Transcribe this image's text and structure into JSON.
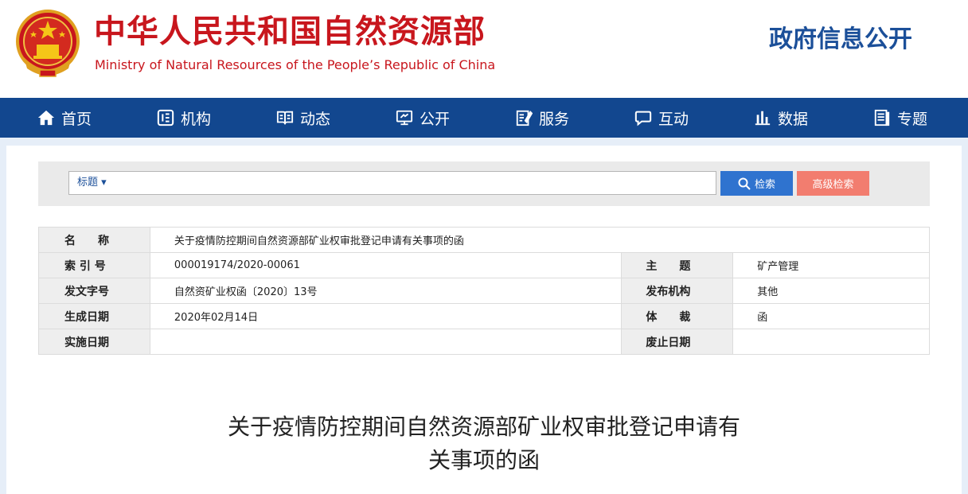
{
  "header": {
    "title_cn": "中华人民共和国自然资源部",
    "title_en": "Ministry of Natural Resources of the People’s Republic of China",
    "section": "政府信息公开",
    "emblem_icon": "national-emblem-icon"
  },
  "nav": {
    "items": [
      {
        "label": "首页",
        "icon": "home-icon"
      },
      {
        "label": "机构",
        "icon": "organization-icon"
      },
      {
        "label": "动态",
        "icon": "book-icon"
      },
      {
        "label": "公开",
        "icon": "monitor-icon"
      },
      {
        "label": "服务",
        "icon": "edit-icon"
      },
      {
        "label": "互动",
        "icon": "chat-icon"
      },
      {
        "label": "数据",
        "icon": "bar-chart-icon"
      },
      {
        "label": "专题",
        "icon": "document-icon"
      }
    ]
  },
  "search": {
    "type_label": "标题 ▾",
    "value": "",
    "search_label": "检索",
    "advanced_label": "高级检索"
  },
  "info": {
    "name_label": "名　　称",
    "name_value": "关于疫情防控期间自然资源部矿业权审批登记申请有关事项的函",
    "index_label": "索 引 号",
    "index_value": "000019174/2020-00061",
    "topic_label": "主　　题",
    "topic_value": "矿产管理",
    "docno_label": "发文字号",
    "docno_value": "自然资矿业权函〔2020〕13号",
    "issuer_label": "发布机构",
    "issuer_value": "其他",
    "date_label": "生成日期",
    "date_value": "2020年02月14日",
    "genre_label": "体　　裁",
    "genre_value": "函",
    "effective_label": "实施日期",
    "effective_value": "",
    "expire_label": "废止日期",
    "expire_value": ""
  },
  "document": {
    "title_line1": "关于疫情防控期间自然资源部矿业权审批登记申请有",
    "title_line2": "关事项的函"
  },
  "colors": {
    "brand_red": "#c8161d",
    "nav_blue": "#12478f",
    "search_blue": "#2f73cf",
    "advanced_red": "#f27d6f"
  }
}
